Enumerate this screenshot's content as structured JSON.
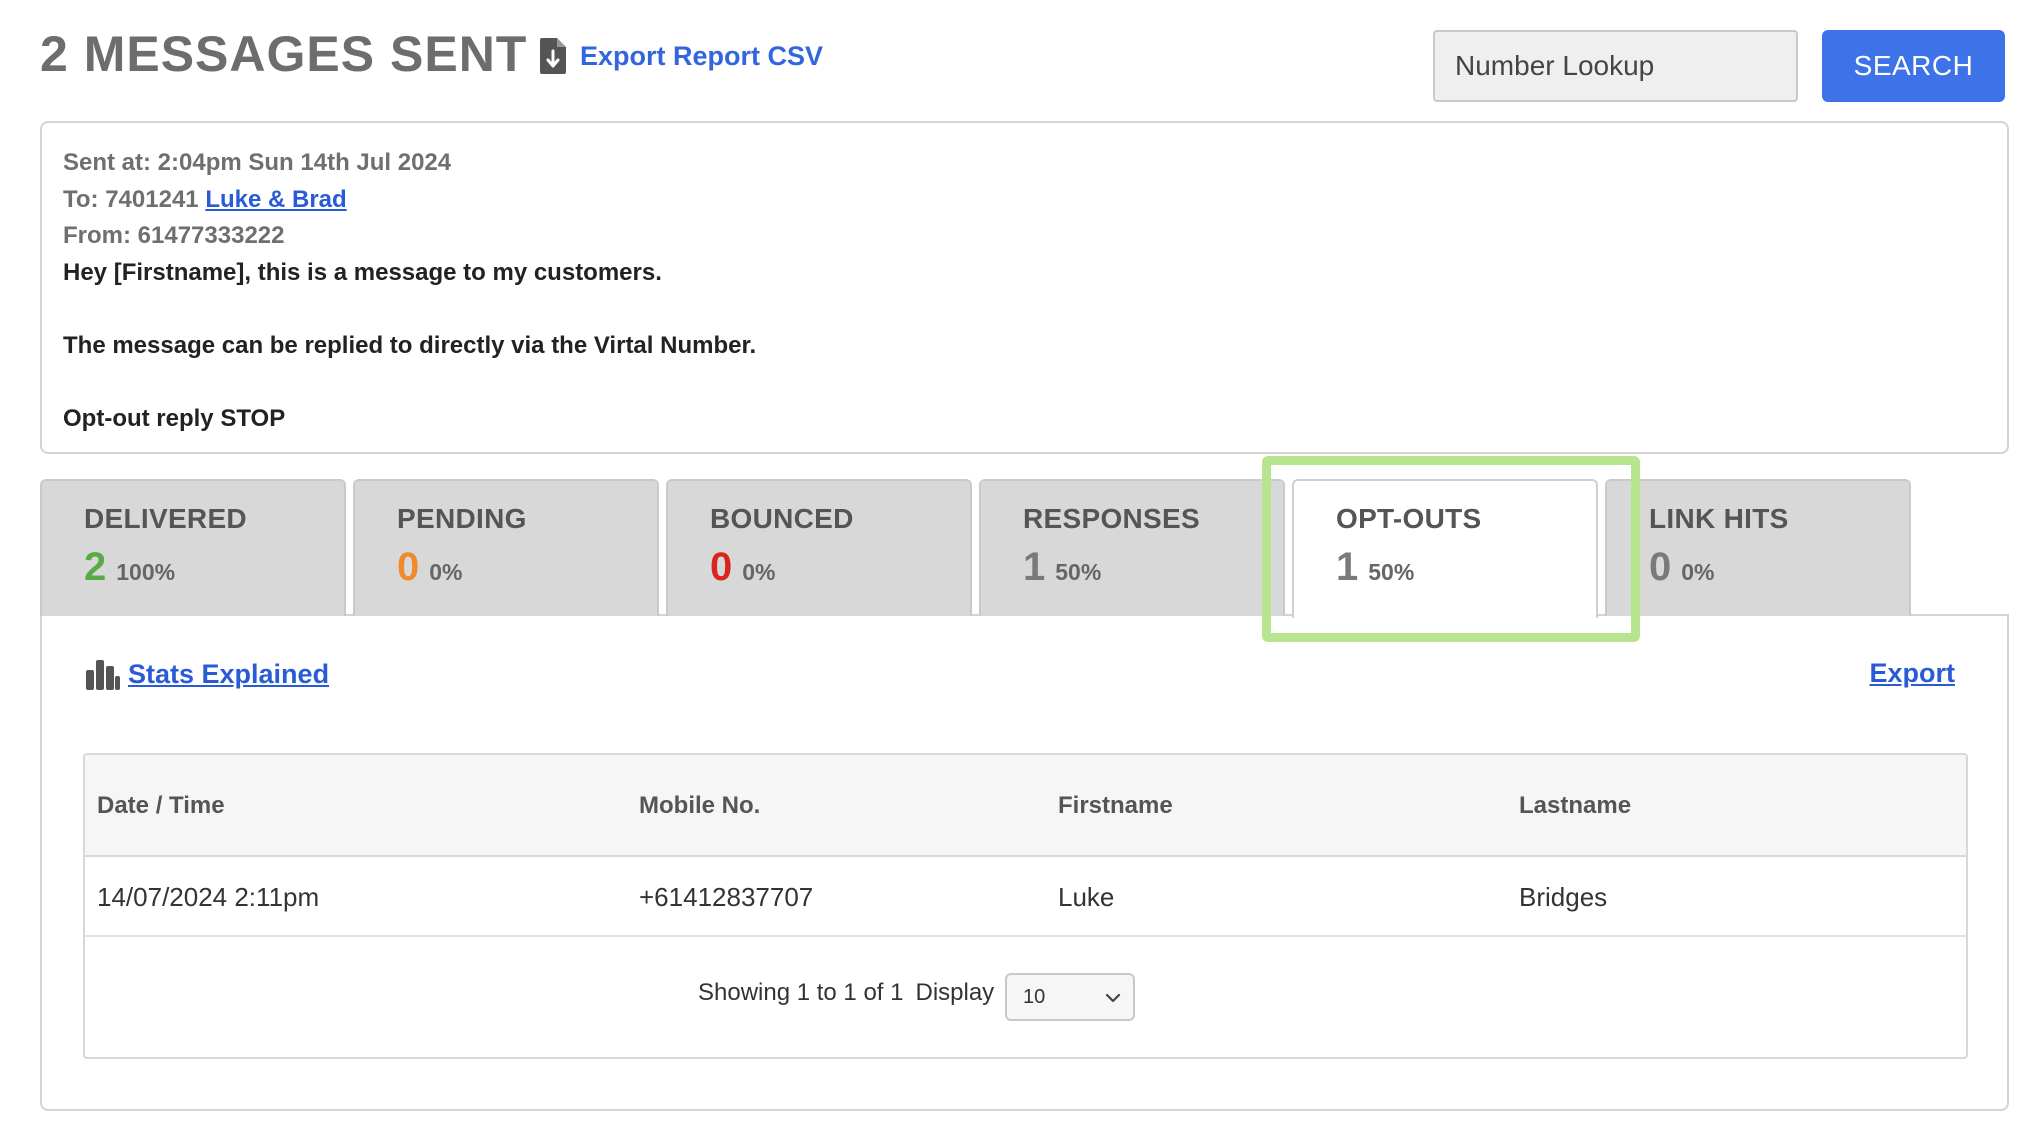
{
  "header": {
    "title": "2 MESSAGES SENT",
    "export_csv_label": "Export Report CSV",
    "lookup_placeholder": "Number Lookup",
    "search_label": "SEARCH",
    "export_icon": "file-download-icon"
  },
  "message": {
    "sent_at": "Sent at: 2:04pm Sun 14th Jul 2024",
    "to_prefix": "To: 7401241 ",
    "to_link": "Luke & Brad",
    "from": "From: 61477333222",
    "body_lines": [
      "Hey [Firstname], this is a message to my customers.",
      "",
      "The message can be replied to directly via the Virtal Number.",
      "",
      "Opt-out reply STOP"
    ]
  },
  "tabs": [
    {
      "label": "DELIVERED",
      "count": "2",
      "pct": "100%",
      "color": "#5aab45"
    },
    {
      "label": "PENDING",
      "count": "0",
      "pct": "0%",
      "color": "#f08a2c"
    },
    {
      "label": "BOUNCED",
      "count": "0",
      "pct": "0%",
      "color": "#d9261c"
    },
    {
      "label": "RESPONSES",
      "count": "1",
      "pct": "50%",
      "color": "#7a7a7a"
    },
    {
      "label": "OPT-OUTS",
      "count": "1",
      "pct": "50%",
      "color": "#7a7a7a",
      "active": true
    },
    {
      "label": "LINK HITS",
      "count": "0",
      "pct": "0%",
      "color": "#7a7a7a"
    }
  ],
  "panel": {
    "stats_link": "Stats Explained",
    "stats_icon": "bar-chart-icon",
    "export_link": "Export"
  },
  "table": {
    "columns": [
      "Date / Time",
      "Mobile No.",
      "Firstname",
      "Lastname"
    ],
    "rows": [
      [
        "14/07/2024 2:11pm",
        "+61412837707",
        "Luke",
        "Bridges"
      ]
    ]
  },
  "pager": {
    "showing": "Showing 1 to 1 of 1",
    "display_label": "Display",
    "display_value": "10"
  },
  "accent_color": "#3d72e8",
  "highlight_color": "#b7e58e"
}
